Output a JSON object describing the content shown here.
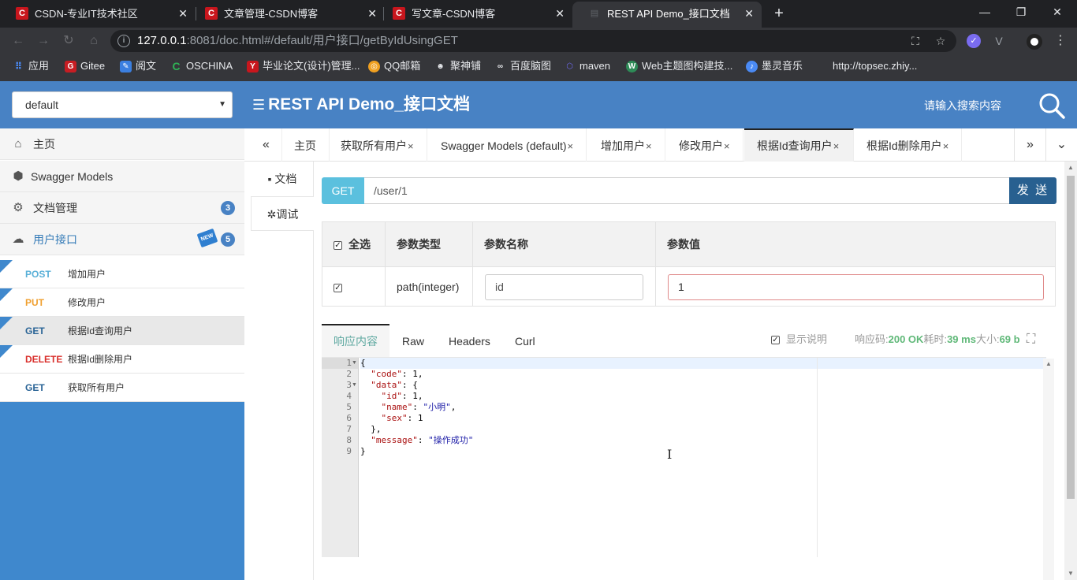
{
  "browser": {
    "tabs": [
      {
        "title": "CSDN-专业IT技术社区",
        "icon": "C"
      },
      {
        "title": "文章管理-CSDN博客",
        "icon": "C"
      },
      {
        "title": "写文章-CSDN博客",
        "icon": "C"
      },
      {
        "title": "REST API Demo_接口文档",
        "icon": "doc"
      }
    ],
    "url_host": "127.0.0.1",
    "url_rest": ":8081/doc.html#/default/用户接口/getByIdUsingGET",
    "bookmarks": [
      "应用",
      "Gitee",
      "阅文",
      "OSCHINA",
      "毕业论文(设计)管理...",
      "QQ邮箱",
      "聚神铺",
      "百度脑图",
      "maven",
      "Web主题图构建技...",
      "墨灵音乐",
      "http://topsec.zhiy..."
    ]
  },
  "header": {
    "group_select": "default",
    "title": "REST API Demo_接口文档",
    "search_placeholder": "请输入搜索内容"
  },
  "sidebar": {
    "home": "主页",
    "models": "Swagger Models",
    "doc_manage": "文档管理",
    "doc_manage_count": "3",
    "user_api": "用户接口",
    "user_api_count": "5",
    "new_badge": "NEW",
    "apis": [
      {
        "method": "POST",
        "name": "增加用户",
        "color": "#5ab0d8"
      },
      {
        "method": "PUT",
        "name": "修改用户",
        "color": "#f0a030"
      },
      {
        "method": "GET",
        "name": "根据Id查询用户",
        "color": "#2a6496"
      },
      {
        "method": "DELETE",
        "name": "根据Id删除用户",
        "color": "#d9302c"
      },
      {
        "method": "GET",
        "name": "获取所有用户",
        "color": "#2a6496"
      }
    ]
  },
  "tabs": {
    "items": [
      "主页",
      "获取所有用户",
      "Swagger Models (default)",
      "增加用户",
      "修改用户",
      "根据Id查询用户",
      "根据Id删除用户"
    ],
    "close": "×"
  },
  "side_tabs": {
    "doc": "文档",
    "debug": "调试"
  },
  "request": {
    "method": "GET",
    "url": "/user/1",
    "send": "发 送"
  },
  "params": {
    "headers": {
      "select_all": "全选",
      "type": "参数类型",
      "name": "参数名称",
      "value": "参数值"
    },
    "row": {
      "type": "path(integer)",
      "name": "id",
      "value": "1"
    }
  },
  "response": {
    "tabs": [
      "响应内容",
      "Raw",
      "Headers",
      "Curl"
    ],
    "show_desc": "显示说明",
    "code_label": "响应码:",
    "code": "200 OK",
    "time_label": "耗时:",
    "time": "39 ms",
    "size_label": "大小:",
    "size": "69 b"
  }
}
